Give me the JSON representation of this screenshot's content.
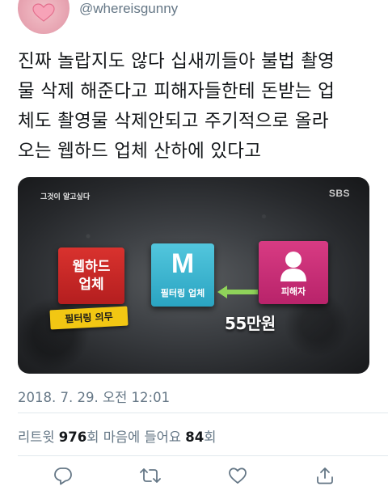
{
  "author": {
    "handle": "@whereisgunny"
  },
  "tweet": {
    "text": "진짜 놀랍지도 않다 십새끼들아 불법 촬영\n물 삭제 해준다고 피해자들한테 돈받는 업\n체도 촬영물 삭제안되고 주기적으로 올라\n오는 웹하드 업체 산하에 있다고"
  },
  "media": {
    "show_title": "그것이 알고싶다",
    "network_logo": "SBS",
    "box_webhard": "웹하드\n업체",
    "tag_filtering_duty": "필터링 의무",
    "box_m_letter": "M",
    "box_m_caption": "필터링 업체",
    "box_victim_caption": "피해자",
    "amount": "55만원",
    "colors": {
      "red": "#c62828",
      "cyan": "#3bb6d1",
      "pink": "#c92f77",
      "yellow": "#f2c713",
      "arrow": "#8fd35a"
    }
  },
  "timestamp": "2018. 7. 29. 오전 12:01",
  "stats": {
    "retweets_label": "리트윗",
    "retweets_count": "976",
    "retweets_unit": "회",
    "likes_label": "마음에 들어요",
    "likes_count": "84",
    "likes_unit": "회"
  },
  "actions": {
    "icons": [
      "reply-icon",
      "retweet-icon",
      "like-icon",
      "share-icon"
    ],
    "icon_color": "#657786"
  }
}
